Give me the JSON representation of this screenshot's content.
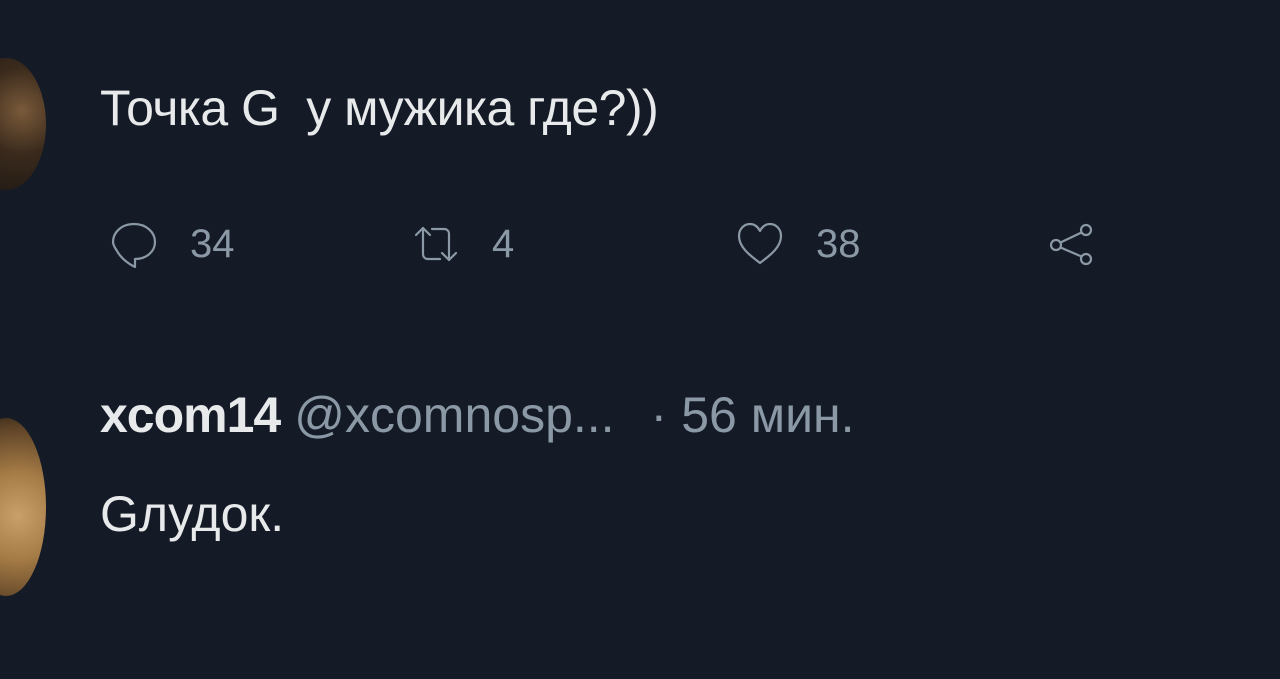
{
  "tweet": {
    "text": "Точка G  у мужика где?))",
    "actions": {
      "replies": "34",
      "retweets": "4",
      "likes": "38"
    }
  },
  "reply": {
    "name": "xcom14",
    "handle": "@xcomnosp...",
    "separator": "·",
    "time": "56 мин.",
    "text": "Gлудок."
  },
  "colors": {
    "background": "#141b26",
    "text_primary": "#e7e9ea",
    "text_secondary": "#8b98a5"
  },
  "icons": {
    "reply": "speech-bubble-icon",
    "retweet": "retweet-icon",
    "like": "heart-icon",
    "share": "share-icon"
  }
}
